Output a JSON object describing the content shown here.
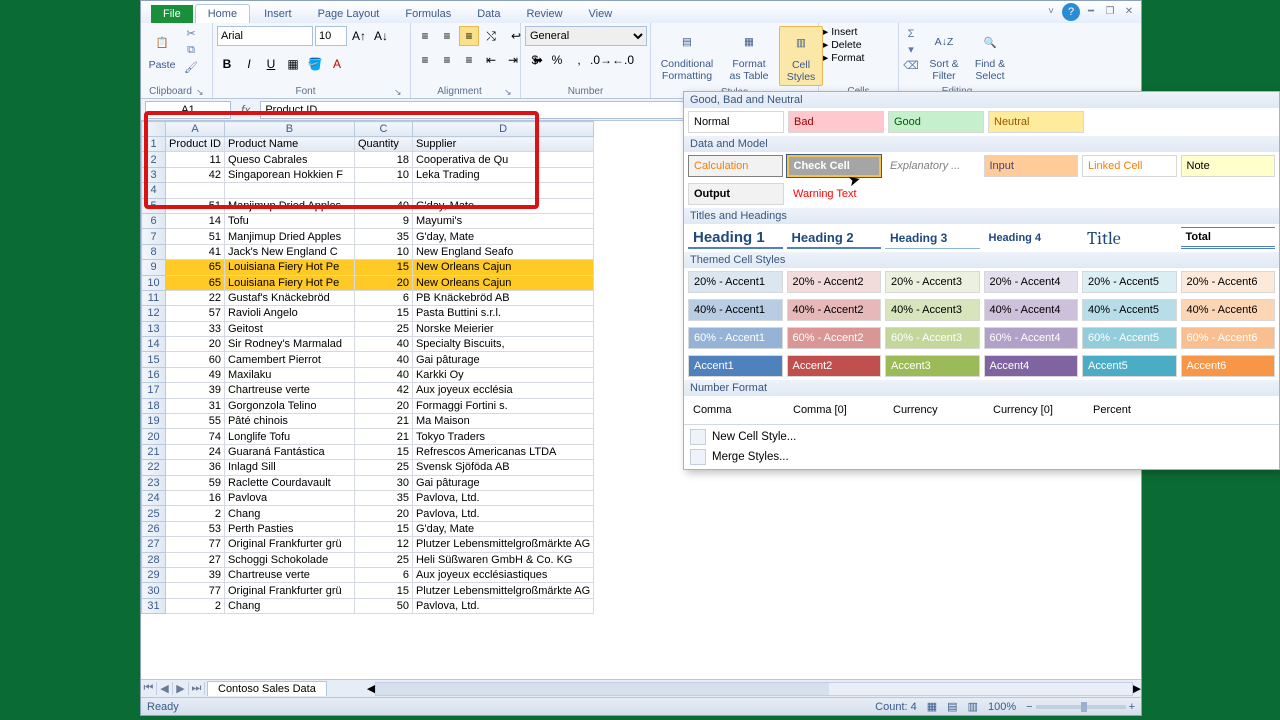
{
  "tabs": {
    "file": "File",
    "home": "Home",
    "insert": "Insert",
    "pagelayout": "Page Layout",
    "formulas": "Formulas",
    "data": "Data",
    "review": "Review",
    "view": "View"
  },
  "ribbon": {
    "clipboard": {
      "label": "Clipboard",
      "paste": "Paste"
    },
    "font": {
      "label": "Font",
      "name": "Arial",
      "size": "10"
    },
    "alignment": {
      "label": "Alignment"
    },
    "number": {
      "label": "Number",
      "format": "General"
    },
    "styles": {
      "cond": "Conditional Formatting",
      "table": "Format as Table",
      "cell": "Cell Styles"
    },
    "cells": {
      "insert": "Insert",
      "delete": "Delete",
      "format": "Format"
    },
    "editing": {
      "sort": "Sort & Filter",
      "find": "Find & Select"
    }
  },
  "formula_bar": {
    "name": "A1",
    "value": "Product ID"
  },
  "columns": [
    "",
    "A",
    "B",
    "C",
    "D"
  ],
  "headers": {
    "a": "Product ID",
    "b": "Product Name",
    "c": "Quantity",
    "d": "Supplier"
  },
  "rows": [
    {
      "n": 2,
      "a": "11",
      "b": "Queso Cabrales",
      "c": "18",
      "d": "Cooperativa de Qu"
    },
    {
      "n": 3,
      "a": "42",
      "b": "Singaporean Hokkien F",
      "c": "10",
      "d": "Leka Trading"
    },
    {
      "n": 4,
      "a": "",
      "b": "",
      "c": "",
      "d": ""
    },
    {
      "n": 5,
      "a": "51",
      "b": "Manjimup Dried Apples",
      "c": "40",
      "d": "G'day, Mate"
    },
    {
      "n": 6,
      "a": "14",
      "b": "Tofu",
      "c": "9",
      "d": "Mayumi's"
    },
    {
      "n": 7,
      "a": "51",
      "b": "Manjimup Dried Apples",
      "c": "35",
      "d": "G'day, Mate"
    },
    {
      "n": 8,
      "a": "41",
      "b": "Jack's New England C",
      "c": "10",
      "d": "New England Seafo"
    },
    {
      "n": 9,
      "a": "65",
      "b": "Louisiana Fiery Hot Pe",
      "c": "15",
      "d": "New Orleans Cajun",
      "hl": true
    },
    {
      "n": 10,
      "a": "65",
      "b": "Louisiana Fiery Hot Pe",
      "c": "20",
      "d": "New Orleans Cajun",
      "hl": true
    },
    {
      "n": 11,
      "a": "22",
      "b": "Gustaf's Knäckebröd",
      "c": "6",
      "d": "PB Knäckebröd AB"
    },
    {
      "n": 12,
      "a": "57",
      "b": "Ravioli Angelo",
      "c": "15",
      "d": "Pasta Buttini s.r.l."
    },
    {
      "n": 13,
      "a": "33",
      "b": "Geitost",
      "c": "25",
      "d": "Norske Meierier"
    },
    {
      "n": 14,
      "a": "20",
      "b": "Sir Rodney's Marmalad",
      "c": "40",
      "d": "Specialty Biscuits,"
    },
    {
      "n": 15,
      "a": "60",
      "b": "Camembert Pierrot",
      "c": "40",
      "d": "Gai pâturage"
    },
    {
      "n": 16,
      "a": "49",
      "b": "Maxilaku",
      "c": "40",
      "d": "Karkki Oy"
    },
    {
      "n": 17,
      "a": "39",
      "b": "Chartreuse verte",
      "c": "42",
      "d": "Aux joyeux ecclésia"
    },
    {
      "n": 18,
      "a": "31",
      "b": "Gorgonzola Telino",
      "c": "20",
      "d": "Formaggi Fortini s."
    },
    {
      "n": 19,
      "a": "55",
      "b": "Pâté chinois",
      "c": "21",
      "d": "Ma Maison"
    },
    {
      "n": 20,
      "a": "74",
      "b": "Longlife Tofu",
      "c": "21",
      "d": "Tokyo Traders"
    },
    {
      "n": 21,
      "a": "24",
      "b": "Guaraná Fantástica",
      "c": "15",
      "d": "Refrescos Americanas LTDA"
    },
    {
      "n": 22,
      "a": "36",
      "b": "Inlagd Sill",
      "c": "25",
      "d": "Svensk Sjöföda AB"
    },
    {
      "n": 23,
      "a": "59",
      "b": "Raclette Courdavault",
      "c": "30",
      "d": "Gai pâturage"
    },
    {
      "n": 24,
      "a": "16",
      "b": "Pavlova",
      "c": "35",
      "d": "Pavlova, Ltd."
    },
    {
      "n": 25,
      "a": "2",
      "b": "Chang",
      "c": "20",
      "d": "Pavlova, Ltd."
    },
    {
      "n": 26,
      "a": "53",
      "b": "Perth Pasties",
      "c": "15",
      "d": "G'day, Mate"
    },
    {
      "n": 27,
      "a": "77",
      "b": "Original Frankfurter grü",
      "c": "12",
      "d": "Plutzer Lebensmittelgroßmärkte AG"
    },
    {
      "n": 28,
      "a": "27",
      "b": "Schoggi Schokolade",
      "c": "25",
      "d": "Heli Süßwaren GmbH & Co. KG"
    },
    {
      "n": 29,
      "a": "39",
      "b": "Chartreuse verte",
      "c": "6",
      "d": "Aux joyeux ecclésiastiques"
    },
    {
      "n": 30,
      "a": "77",
      "b": "Original Frankfurter grü",
      "c": "15",
      "d": "Plutzer Lebensmittelgroßmärkte AG"
    },
    {
      "n": 31,
      "a": "2",
      "b": "Chang",
      "c": "50",
      "d": "Pavlova, Ltd."
    }
  ],
  "sheet_tab": "Contoso Sales Data",
  "status": {
    "ready": "Ready",
    "count_lbl": "Count:",
    "count": "4",
    "zoom": "100%"
  },
  "gallery": {
    "sec1": "Good, Bad and Neutral",
    "s1": [
      "Normal",
      "Bad",
      "Good",
      "Neutral"
    ],
    "sec2": "Data and Model",
    "s2a": [
      "Calculation",
      "Check Cell",
      "Explanatory ...",
      "Input",
      "Linked Cell",
      "Note"
    ],
    "s2b": [
      "Output",
      "Warning Text"
    ],
    "sec3": "Titles and Headings",
    "s3": [
      "Heading 1",
      "Heading 2",
      "Heading 3",
      "Heading 4",
      "Title",
      "Total"
    ],
    "sec4": "Themed Cell Styles",
    "s4a": [
      "20% - Accent1",
      "20% - Accent2",
      "20% - Accent3",
      "20% - Accent4",
      "20% - Accent5",
      "20% - Accent6"
    ],
    "s4b": [
      "40% - Accent1",
      "40% - Accent2",
      "40% - Accent3",
      "40% - Accent4",
      "40% - Accent5",
      "40% - Accent6"
    ],
    "s4c": [
      "60% - Accent1",
      "60% - Accent2",
      "60% - Accent3",
      "60% - Accent4",
      "60% - Accent5",
      "60% - Accent6"
    ],
    "s4d": [
      "Accent1",
      "Accent2",
      "Accent3",
      "Accent4",
      "Accent5",
      "Accent6"
    ],
    "sec5": "Number Format",
    "s5": [
      "Comma",
      "Comma [0]",
      "Currency",
      "Currency [0]",
      "Percent"
    ],
    "new": "New Cell Style...",
    "merge": "Merge Styles..."
  }
}
